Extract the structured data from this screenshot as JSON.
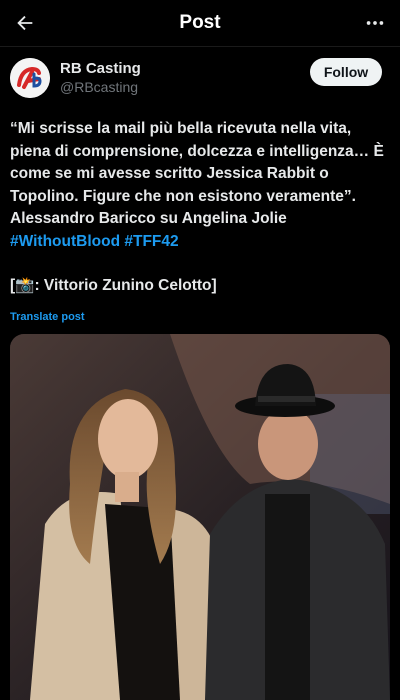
{
  "header": {
    "title": "Post"
  },
  "author": {
    "display_name": "RB Casting",
    "handle": "@RBcasting",
    "follow_label": "Follow"
  },
  "post": {
    "lines": [
      "“Mi scrisse la mail più bella ricevuta nella vita,",
      "piena di comprensione, dolcezza e intelligenza… È",
      "come se mi avesse scritto Jessica Rabbit o",
      "Topolino. Figure che non esistono veramente”.",
      "Alessandro Baricco su Angelina Jolie"
    ],
    "hashtags": [
      "#WithoutBlood",
      "#TFF42"
    ],
    "credit": "[📸: Vittorio Zunino Celotto]"
  },
  "translate_label": "Translate post",
  "colors": {
    "background": "#000000",
    "link": "#1d9bf0",
    "text": "#e7e9ea",
    "muted": "#71767b"
  },
  "icons": [
    "back-arrow-icon",
    "more-icon"
  ]
}
